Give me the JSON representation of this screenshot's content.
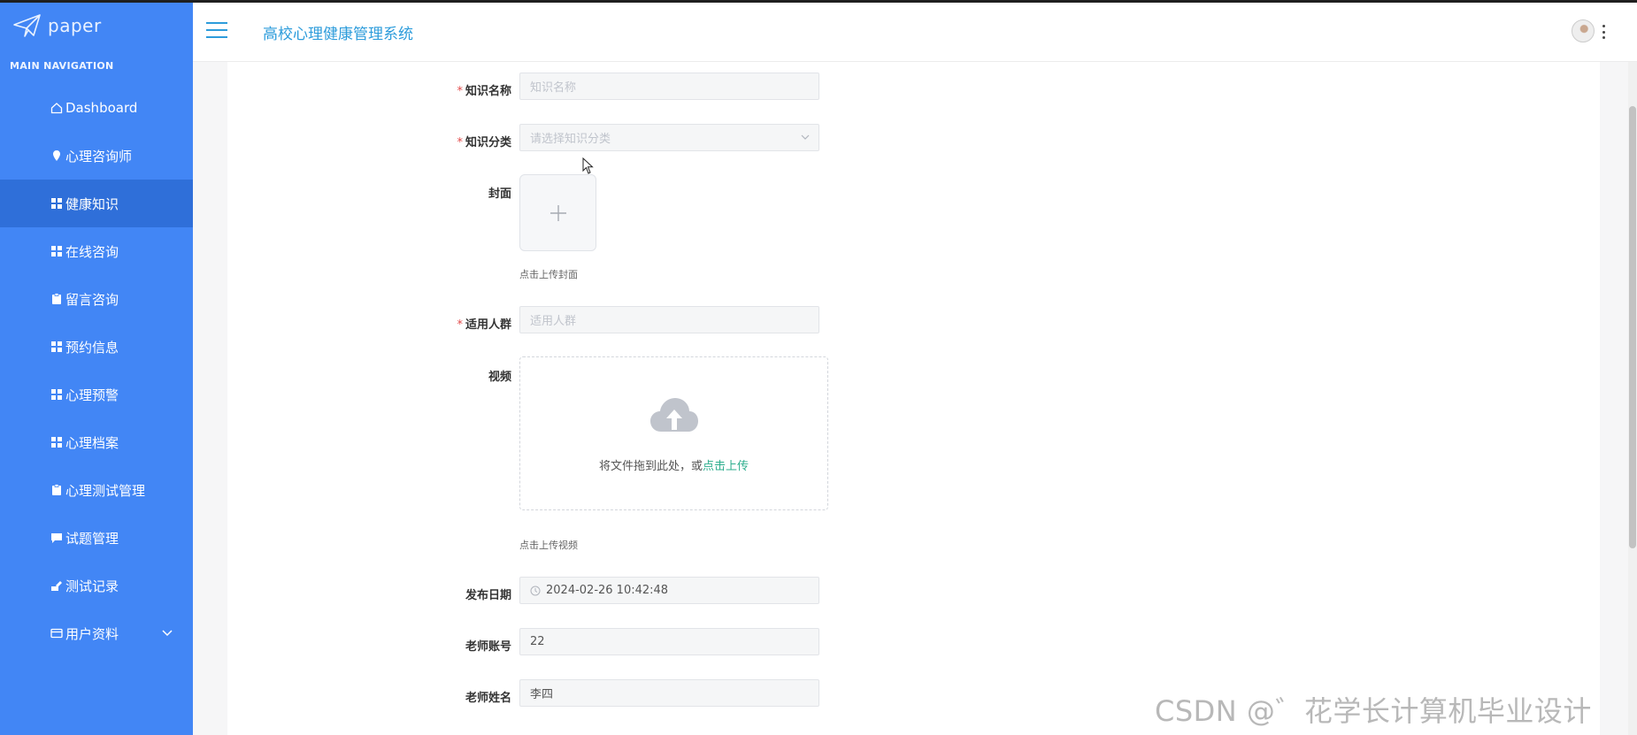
{
  "brand": {
    "logo_text": "paper"
  },
  "sidebar": {
    "heading": "MAIN NAVIGATION",
    "items": [
      {
        "label": "Dashboard",
        "icon": "home-icon"
      },
      {
        "label": "心理咨询师",
        "icon": "pin-icon"
      },
      {
        "label": "健康知识",
        "icon": "grid-icon",
        "active": true
      },
      {
        "label": "在线咨询",
        "icon": "grid-icon"
      },
      {
        "label": "留言咨询",
        "icon": "clipboard-icon"
      },
      {
        "label": "预约信息",
        "icon": "grid-icon"
      },
      {
        "label": "心理预警",
        "icon": "grid-icon"
      },
      {
        "label": "心理档案",
        "icon": "grid-icon"
      },
      {
        "label": "心理测试管理",
        "icon": "clipboard-icon"
      },
      {
        "label": "试题管理",
        "icon": "chat-icon"
      },
      {
        "label": "测试记录",
        "icon": "send-icon"
      },
      {
        "label": "用户资料",
        "icon": "card-icon",
        "expandable": true
      }
    ]
  },
  "header": {
    "title": "高校心理健康管理系统"
  },
  "form": {
    "name": {
      "label": "知识名称",
      "placeholder": "知识名称",
      "required": true
    },
    "category": {
      "label": "知识分类",
      "placeholder": "请选择知识分类",
      "required": true
    },
    "cover": {
      "label": "封面",
      "tip": "点击上传封面"
    },
    "audience": {
      "label": "适用人群",
      "placeholder": "适用人群",
      "required": true
    },
    "video": {
      "label": "视频",
      "drop_text": "将文件拖到此处，或",
      "drop_link": "点击上传",
      "tip": "点击上传视频"
    },
    "publish_date": {
      "label": "发布日期",
      "value": "2024-02-26 10:42:48"
    },
    "teacher_account": {
      "label": "老师账号",
      "value": "22"
    },
    "teacher_name": {
      "label": "老师姓名",
      "value": "李四"
    }
  },
  "required_mark": "*",
  "watermark": "CSDN @゛花学长计算机毕业设计",
  "colors": {
    "sidebar": "#4286f5",
    "sidebar_active": "#2f6fd9",
    "title": "#2d9cdb",
    "link": "#2eae8e",
    "required": "#e24c4c"
  }
}
